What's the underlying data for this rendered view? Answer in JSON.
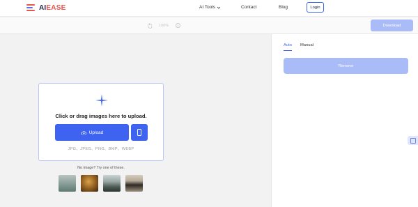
{
  "header": {
    "logo": {
      "prefix": "AI",
      "suffix": "EASE"
    },
    "nav": {
      "ai_tools": "AI Tools",
      "contact": "Contact",
      "blog": "Blog"
    },
    "login": "Login"
  },
  "toolbar": {
    "zoom": "100%",
    "download": "Download"
  },
  "panel": {
    "tabs": [
      "Auto",
      "Manual"
    ],
    "active_tab": "Auto",
    "remove": "Remove"
  },
  "upload": {
    "title": "Click or drag images here to upload.",
    "button": "Upload",
    "formats": "JPG、JPEG、PNG、BMP、WEBP"
  },
  "samples": {
    "hint": "No image? Try one of these."
  },
  "colors": {
    "accent": "#3d63f0",
    "accent_disabled": "#a9bcf7",
    "logo_red": "#e8554d"
  }
}
